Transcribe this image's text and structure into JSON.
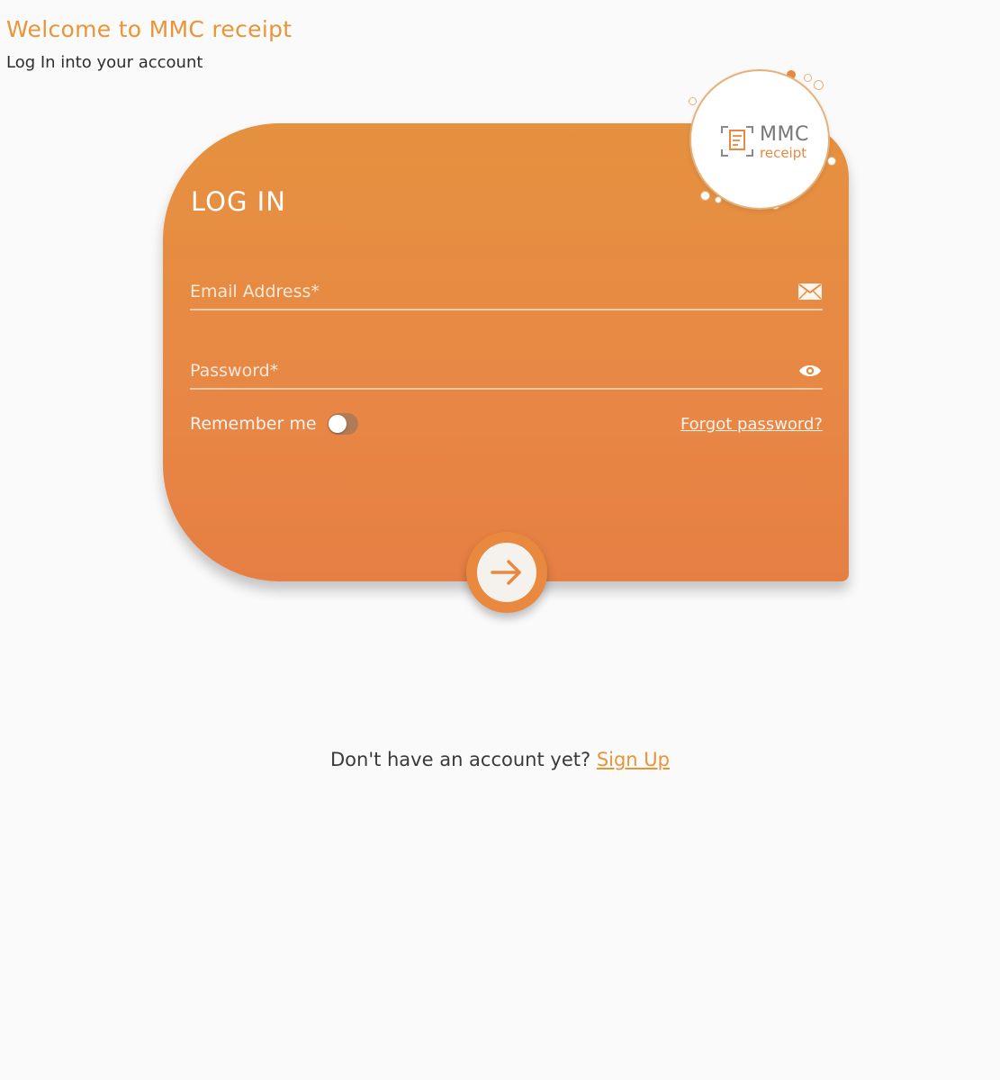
{
  "header": {
    "title": "Welcome to MMC receipt",
    "subtitle": "Log In into your account"
  },
  "logo": {
    "line1": "MMC",
    "line2": "receipt"
  },
  "login_card": {
    "title": "LOG IN",
    "email_placeholder": "Email Address*",
    "email_value": "",
    "password_placeholder": "Password*",
    "password_value": "",
    "remember_label": "Remember me",
    "remember_checked": false,
    "forgot_label": "Forgot password?",
    "email_icon": "envelope-icon",
    "password_icon": "eye-icon",
    "submit_icon": "arrow-right-icon"
  },
  "footer": {
    "prompt": "Don't have an account yet?",
    "signup_label": "Sign Up"
  },
  "colors": {
    "accent": "#e8953a",
    "card": "#e6883f"
  }
}
